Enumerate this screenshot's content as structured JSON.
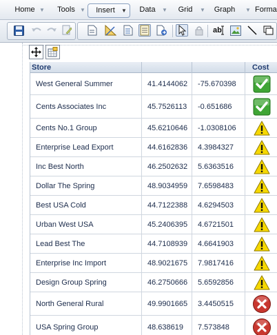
{
  "menu": {
    "items": [
      {
        "label": "Home"
      },
      {
        "label": "Tools"
      },
      {
        "label": "Insert"
      },
      {
        "label": "Data"
      },
      {
        "label": "Grid"
      },
      {
        "label": "Graph"
      },
      {
        "label": "Forma"
      }
    ]
  },
  "toolbar": {
    "icons": [
      "save-icon",
      "undo-icon",
      "redo-icon",
      "edit-page-icon",
      "page-icon",
      "ruler-icon",
      "document-icon",
      "notes-icon",
      "page-arrow-icon",
      "pointer-icon",
      "lock-icon",
      "text-ab-icon",
      "image-icon",
      "line-icon",
      "rectangle-icon"
    ]
  },
  "grid": {
    "headers": {
      "store": "Store",
      "cost": "Cost"
    },
    "rows": [
      {
        "store": "West General Summer",
        "lat": "41.4144062",
        "lon": "-75.670398",
        "status": "ok"
      },
      {
        "store": "Cents Associates Inc",
        "lat": "45.7526113",
        "lon": "-0.651686",
        "status": "ok"
      },
      {
        "store": "Cents No.1 Group",
        "lat": "45.6210646",
        "lon": "-1.0308106",
        "status": "warning"
      },
      {
        "store": "Enterprise Lead Export",
        "lat": "44.6162836",
        "lon": "4.3984327",
        "status": "warning"
      },
      {
        "store": "Inc Best North",
        "lat": "46.2502632",
        "lon": "5.6363516",
        "status": "warning"
      },
      {
        "store": "Dollar The Spring",
        "lat": "48.9034959",
        "lon": "7.6598483",
        "status": "warning"
      },
      {
        "store": "Best USA Cold",
        "lat": "44.7122388",
        "lon": "4.6294503",
        "status": "warning"
      },
      {
        "store": "Urban West USA",
        "lat": "45.2406395",
        "lon": "4.6721501",
        "status": "warning"
      },
      {
        "store": "Lead Best The",
        "lat": "44.7108939",
        "lon": "4.6641903",
        "status": "warning"
      },
      {
        "store": "Enterprise Inc Import",
        "lat": "48.9021675",
        "lon": "7.9817416",
        "status": "warning"
      },
      {
        "store": "Design Group Spring",
        "lat": "46.2750666",
        "lon": "5.6592856",
        "status": "warning"
      },
      {
        "store": "North General Rural",
        "lat": "49.9901665",
        "lon": "3.4450515",
        "status": "error"
      },
      {
        "store": "USA Spring Group",
        "lat": "48.638619",
        "lon": "7.573848",
        "status": "error"
      }
    ]
  },
  "colors": {
    "ok": "#3fa535",
    "warning": "#f6d800",
    "error": "#c8372f",
    "header_text": "#1e3a6e"
  }
}
